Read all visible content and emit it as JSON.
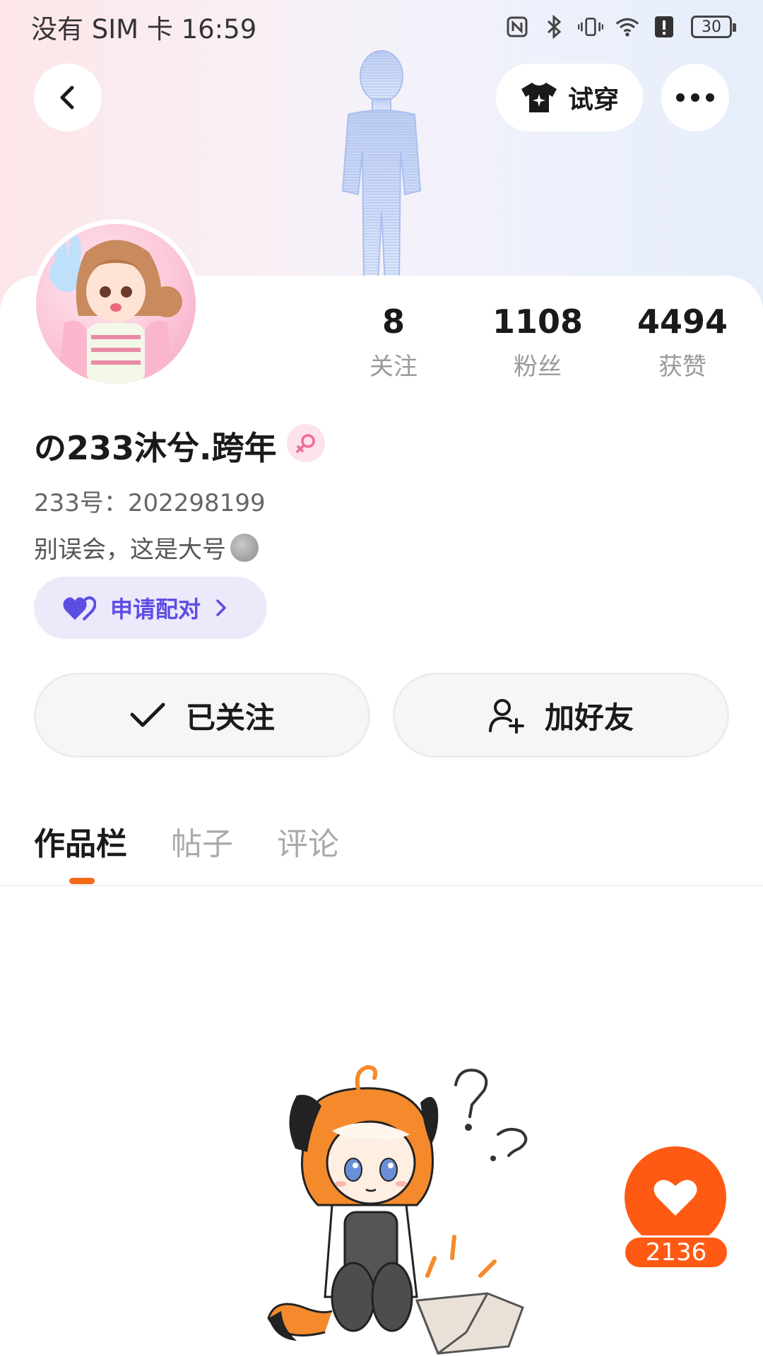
{
  "status_bar": {
    "carrier_time": "没有 SIM 卡 16:59",
    "battery": "30",
    "icons": [
      "nfc-icon",
      "bluetooth-icon",
      "vibrate-icon",
      "wifi-icon",
      "alert-icon",
      "battery-icon"
    ]
  },
  "header": {
    "back_icon": "chevron-left-icon",
    "try_on_label": "试穿",
    "try_on_icon": "tshirt-icon",
    "more_icon": "more-dots-icon"
  },
  "profile": {
    "stats": [
      {
        "value": "8",
        "label": "关注"
      },
      {
        "value": "1108",
        "label": "粉丝"
      },
      {
        "value": "4494",
        "label": "获赞"
      }
    ],
    "username": "の233沐兮.跨年",
    "gender_icon": "female-icon",
    "uid": "233号：202298199",
    "bio": "别误会，这是大号",
    "pair_label": "申请配对"
  },
  "actions": {
    "follow_label": "已关注",
    "add_friend_label": "加好友"
  },
  "tabs": [
    {
      "label": "作品栏",
      "active": true
    },
    {
      "label": "帖子",
      "active": false
    },
    {
      "label": "评论",
      "active": false
    }
  ],
  "like": {
    "count": "2136"
  },
  "colors": {
    "accent_orange": "#ff5a14",
    "pair_purple": "#5c4ee3",
    "pair_bg": "#ece9fb"
  }
}
